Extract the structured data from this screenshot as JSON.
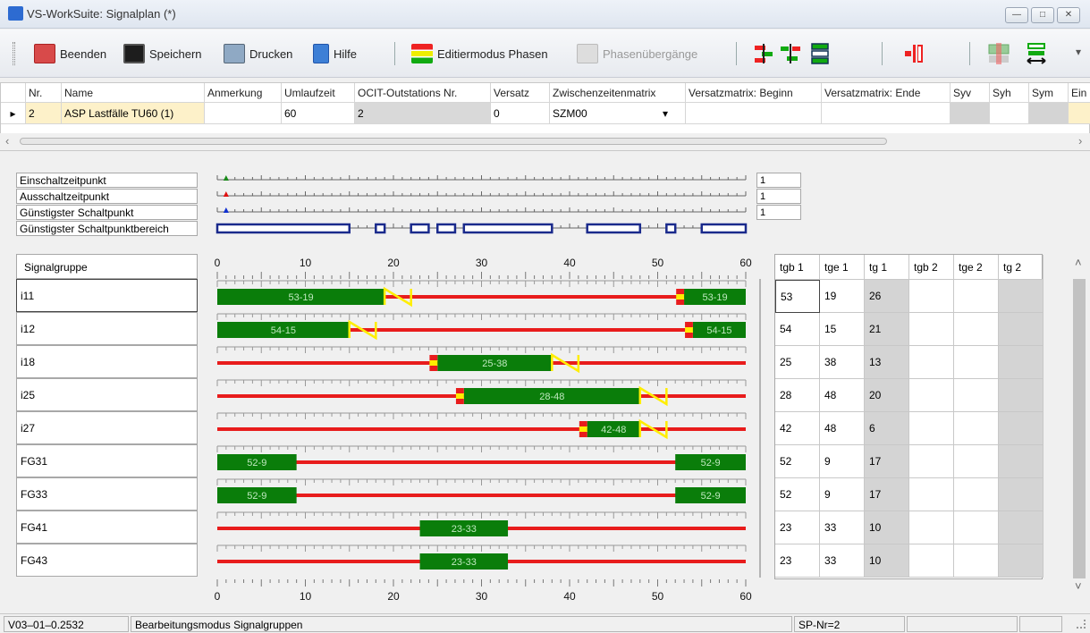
{
  "window": {
    "title": "VS-WorkSuite: Signalplan (*)",
    "min_glyph": "—",
    "max_glyph": "□",
    "close_glyph": "✕"
  },
  "toolbar": {
    "exit": "Beenden",
    "save": "Speichern",
    "print": "Drucken",
    "help": "Hilfe",
    "edit_phases": "Editiermodus Phasen",
    "phase_transitions": "Phasenübergänge",
    "overflow": "▾"
  },
  "grid": {
    "columns": [
      "Nr.",
      "Name",
      "Anmerkung",
      "Umlaufzeit",
      "OCIT-Outstations Nr.",
      "Versatz",
      "Zwischenzeitenmatrix",
      "Versatzmatrix: Beginn",
      "Versatzmatrix: Ende",
      "Syv",
      "Syh",
      "Sym",
      "Ein"
    ],
    "row": {
      "marker": "▸",
      "nr": "2",
      "name": "ASP  Lastfälle TU60 (1)",
      "anmerkung": "",
      "umlaufzeit": "60",
      "ocit": "2",
      "versatz": "0",
      "zwischenzeitenmatrix": "SZM00",
      "dropdown": "▾",
      "vm_beginn": "",
      "vm_ende": "",
      "syv": "",
      "syh": "",
      "sym": "",
      "ein": ""
    },
    "scroll_left": "‹",
    "scroll_right": "›"
  },
  "events": {
    "labels": [
      "Einschaltzeitpunkt",
      "Ausschaltzeitpunkt",
      "Günstigster Schaltpunkt",
      "Günstigster Schaltpunktbereich"
    ],
    "values": [
      "1",
      "1",
      "1"
    ],
    "marker_colors": [
      "#1a8a1a",
      "#e01010",
      "#1030d0"
    ],
    "ranges": [
      [
        0,
        15
      ],
      [
        18,
        19
      ],
      [
        22,
        24
      ],
      [
        25,
        27
      ],
      [
        28,
        38
      ],
      [
        42,
        48
      ],
      [
        51,
        52
      ],
      [
        55,
        60
      ]
    ]
  },
  "signal_header": "Signalgruppe",
  "chart_data": {
    "type": "signal-timing",
    "cycle": 60,
    "xticks": [
      0,
      10,
      20,
      30,
      40,
      50,
      60
    ],
    "colors": {
      "green": "#0a7d0a",
      "red": "#e81c1c",
      "yellow": "#ffee00"
    },
    "groups": [
      {
        "name": "i11",
        "green": [
          [
            53,
            60
          ],
          [
            0,
            19
          ]
        ],
        "label": "53-19",
        "amber": [
          [
            19,
            22
          ]
        ],
        "redamber": [
          [
            52,
            53
          ]
        ]
      },
      {
        "name": "i12",
        "green": [
          [
            54,
            60
          ],
          [
            0,
            15
          ]
        ],
        "label": "54-15",
        "amber": [
          [
            15,
            18
          ]
        ],
        "redamber": [
          [
            53,
            54
          ]
        ]
      },
      {
        "name": "i18",
        "green": [
          [
            25,
            38
          ]
        ],
        "label": "25-38",
        "amber": [
          [
            38,
            41
          ]
        ],
        "redamber": [
          [
            24,
            25
          ]
        ]
      },
      {
        "name": "i25",
        "green": [
          [
            28,
            48
          ]
        ],
        "label": "28-48",
        "amber": [
          [
            48,
            51
          ]
        ],
        "redamber": [
          [
            27,
            28
          ]
        ]
      },
      {
        "name": "i27",
        "green": [
          [
            42,
            48
          ]
        ],
        "label": "42-48",
        "amber": [
          [
            48,
            51
          ]
        ],
        "redamber": [
          [
            41,
            42
          ]
        ]
      },
      {
        "name": "FG31",
        "green": [
          [
            52,
            60
          ],
          [
            0,
            9
          ]
        ],
        "label": "52-9",
        "amber": [],
        "redamber": []
      },
      {
        "name": "FG33",
        "green": [
          [
            52,
            60
          ],
          [
            0,
            9
          ]
        ],
        "label": "52-9",
        "amber": [],
        "redamber": []
      },
      {
        "name": "FG41",
        "green": [
          [
            23,
            33
          ]
        ],
        "label": "23-33",
        "amber": [],
        "redamber": []
      },
      {
        "name": "FG43",
        "green": [
          [
            23,
            33
          ]
        ],
        "label": "23-33",
        "amber": [],
        "redamber": []
      }
    ]
  },
  "table": {
    "headers": [
      "tgb 1",
      "tge 1",
      "tg 1",
      "tgb 2",
      "tge 2",
      "tg 2"
    ],
    "rows": [
      [
        "53",
        "19",
        "26",
        "",
        "",
        ""
      ],
      [
        "54",
        "15",
        "21",
        "",
        "",
        ""
      ],
      [
        "25",
        "38",
        "13",
        "",
        "",
        ""
      ],
      [
        "28",
        "48",
        "20",
        "",
        "",
        ""
      ],
      [
        "42",
        "48",
        "6",
        "",
        "",
        ""
      ],
      [
        "52",
        "9",
        "17",
        "",
        "",
        ""
      ],
      [
        "52",
        "9",
        "17",
        "",
        "",
        ""
      ],
      [
        "23",
        "33",
        "10",
        "",
        "",
        ""
      ],
      [
        "23",
        "33",
        "10",
        "",
        "",
        ""
      ]
    ]
  },
  "scrollbar": {
    "up": "˄",
    "down": "˅"
  },
  "status": {
    "version": "V03–01–0.2532",
    "mode": "Bearbeitungsmodus Signalgruppen",
    "plan": "SP-Nr=2"
  }
}
